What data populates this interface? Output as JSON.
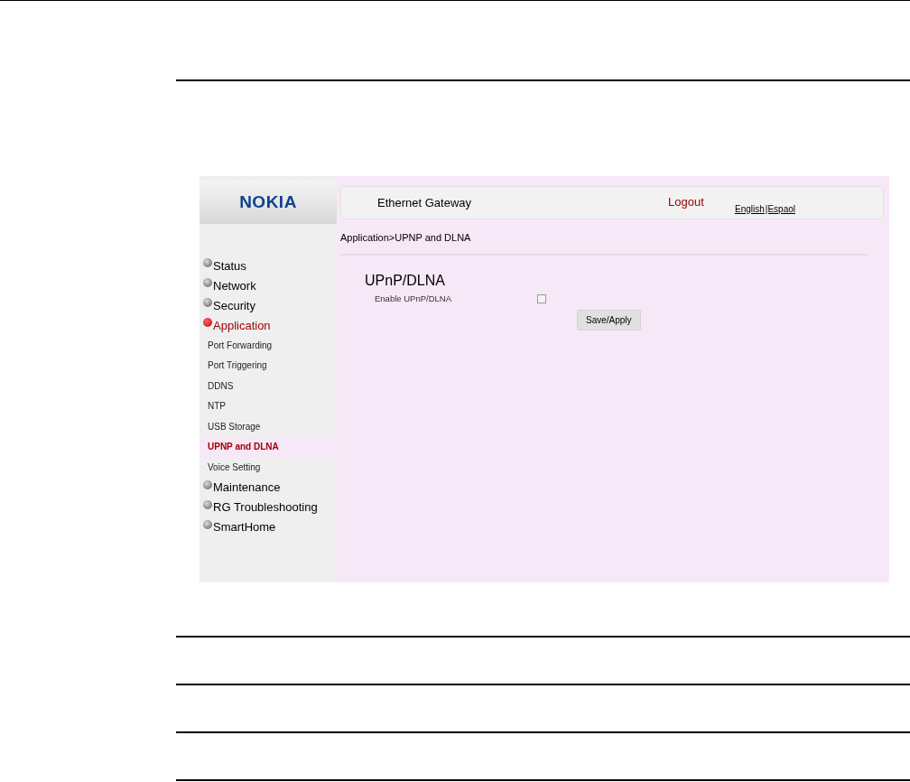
{
  "header": {
    "logo": "NOKIA",
    "title": "Ethernet Gateway",
    "logout": "Logout",
    "languages": [
      {
        "label": "English"
      },
      {
        "label": "|Espaol"
      }
    ]
  },
  "breadcrumb": "Application>UPNP and DLNA",
  "sidebar": {
    "items": [
      {
        "label": "Status",
        "expanded": false
      },
      {
        "label": "Network",
        "expanded": false
      },
      {
        "label": "Security",
        "expanded": false
      },
      {
        "label": "Application",
        "expanded": true,
        "children": [
          {
            "label": "Port Forwarding",
            "selected": false
          },
          {
            "label": "Port Triggering",
            "selected": false
          },
          {
            "label": "DDNS",
            "selected": false
          },
          {
            "label": "NTP",
            "selected": false
          },
          {
            "label": "USB Storage",
            "selected": false
          },
          {
            "label": "UPNP and DLNA",
            "selected": true
          },
          {
            "label": "Voice Setting",
            "selected": false
          }
        ]
      },
      {
        "label": "Maintenance",
        "expanded": false
      },
      {
        "label": "RG Troubleshooting",
        "expanded": false
      },
      {
        "label": "SmartHome",
        "expanded": false
      }
    ]
  },
  "section": {
    "title": "UPnP/DLNA",
    "option": {
      "label": "Enable UPnP/DLNA",
      "checked": false
    },
    "button": "Save/Apply"
  }
}
